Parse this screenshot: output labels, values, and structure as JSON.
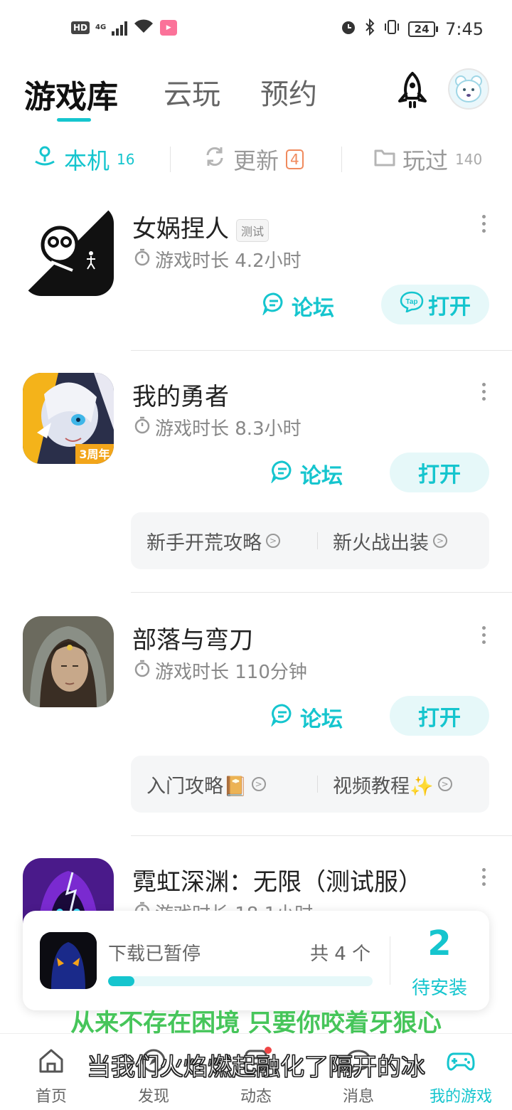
{
  "status_bar": {
    "hd": "HD",
    "network": "4G",
    "time": "7:45",
    "battery": "24"
  },
  "header": {
    "tabs": [
      {
        "label": "游戏库",
        "active": true
      },
      {
        "label": "云玩",
        "active": false
      },
      {
        "label": "预约",
        "active": false
      }
    ],
    "icons": [
      "rocket-icon",
      "avatar"
    ]
  },
  "subtabs": [
    {
      "label": "本机",
      "count": "16",
      "active": true,
      "icon": "joystick-icon"
    },
    {
      "label": "更新",
      "badge": "4",
      "active": false,
      "icon": "refresh-icon"
    },
    {
      "label": "玩过",
      "count": "140",
      "active": false,
      "icon": "folder-icon"
    }
  ],
  "games": [
    {
      "title": "女娲捏人",
      "tag": "测试",
      "playtime": "游戏时长 4.2小时",
      "forum_label": "论坛",
      "open_label": "打开",
      "open_has_tap_icon": true
    },
    {
      "title": "我的勇者",
      "playtime": "游戏时长 8.3小时",
      "forum_label": "论坛",
      "open_label": "打开",
      "icon_badge": "3周年",
      "guides": [
        "新手开荒攻略",
        "新火战出装"
      ]
    },
    {
      "title": "部落与弯刀",
      "playtime": "游戏时长 110分钟",
      "forum_label": "论坛",
      "open_label": "打开",
      "guides": [
        "入门攻略📔",
        "视频教程✨"
      ]
    },
    {
      "title": "霓虹深渊：无限（测试服）",
      "playtime": "游戏时长 18.1小时"
    }
  ],
  "download": {
    "status": "下载已暂停",
    "total": "共 4 个",
    "progress": 0.1,
    "pending_count": "2",
    "pending_label": "待安装"
  },
  "subtitles": {
    "line1": "从来不存在困境 只要你咬着牙狠心",
    "line2": "当我们火焰燃起融化了隔开的冰"
  },
  "bottom_nav": [
    {
      "label": "首页",
      "icon": "home-icon",
      "active": false
    },
    {
      "label": "发现",
      "icon": "discover-icon",
      "active": false
    },
    {
      "label": "动态",
      "icon": "feed-icon",
      "active": false
    },
    {
      "label": "消息",
      "icon": "message-icon",
      "active": false
    },
    {
      "label": "我的游戏",
      "icon": "gamepad-icon",
      "active": true
    }
  ],
  "colors": {
    "accent": "#15c5ce",
    "badge_orange": "#f08a5d",
    "subtitle_green": "#46c55a"
  }
}
